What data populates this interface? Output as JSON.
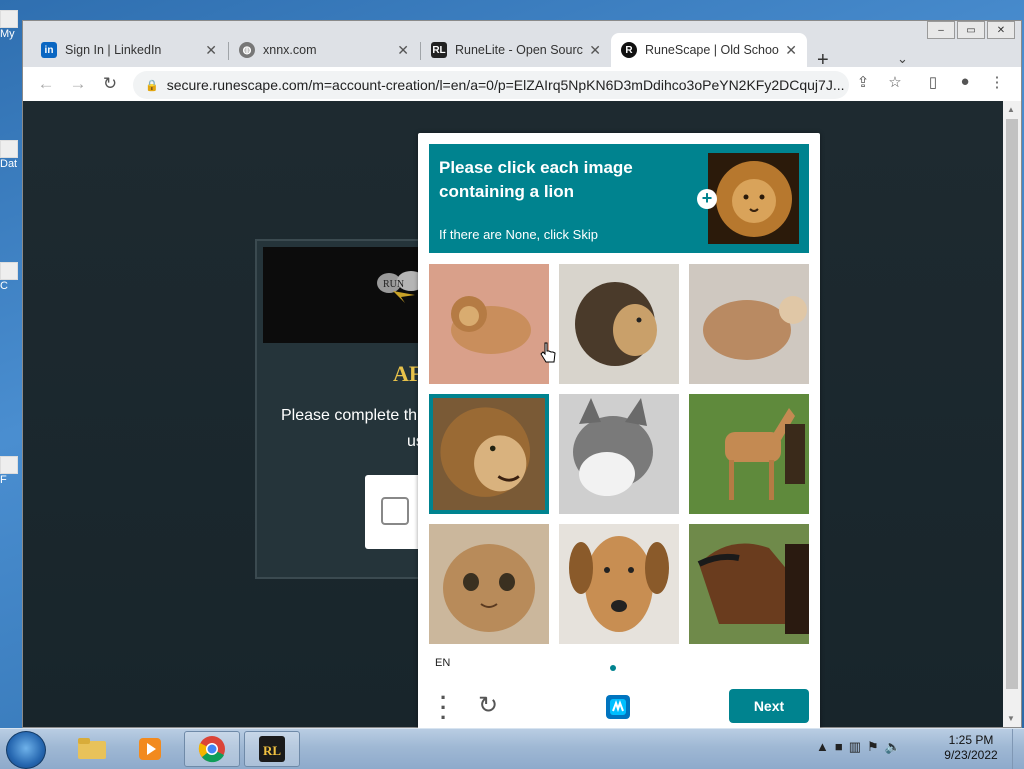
{
  "desktop": {
    "icons": [
      {
        "label": "My",
        "icon": "computer-icon"
      },
      {
        "label": "Dat",
        "icon": "data-icon"
      },
      {
        "label": "C",
        "icon": "app-icon"
      },
      {
        "label": "F",
        "icon": "file-icon"
      }
    ]
  },
  "browser": {
    "tabs": [
      {
        "title": "Sign In | LinkedIn",
        "icon": "linkedin-icon",
        "active": false
      },
      {
        "title": "xnnx.com",
        "icon": "globe-icon",
        "active": false
      },
      {
        "title": "RuneLite - Open Source",
        "icon": "runelite-icon",
        "active": false
      },
      {
        "title": "RuneScape | Old School",
        "icon": "runescape-icon",
        "active": true
      }
    ],
    "url": "secure.runescape.com/m=account-creation/l=en/a=0/p=ElZAIrq5NpKN6D3mDdihco3oPeYN2KFy2DCquj7J..."
  },
  "page": {
    "heading": "AF",
    "instructions_line1": "Please complete th",
    "instructions_line2": "us"
  },
  "captcha": {
    "prompt": "Please click each image containing a lion",
    "subtext": "If there are None, click Skip",
    "example_label": "lion",
    "images": [
      {
        "subject": "lion",
        "selected": false
      },
      {
        "subject": "lion",
        "selected": false
      },
      {
        "subject": "bear",
        "selected": false
      },
      {
        "subject": "lion",
        "selected": true
      },
      {
        "subject": "cat",
        "selected": false
      },
      {
        "subject": "foal",
        "selected": false
      },
      {
        "subject": "kitten",
        "selected": false
      },
      {
        "subject": "dog",
        "selected": false
      },
      {
        "subject": "horse",
        "selected": false
      }
    ],
    "language": "EN",
    "next_label": "Next",
    "accent": "#00838f"
  },
  "taskbar": {
    "time": "1:25 PM",
    "date": "9/23/2022",
    "apps": [
      "explorer-icon",
      "media-player-icon",
      "chrome-icon",
      "runelite-icon"
    ]
  }
}
